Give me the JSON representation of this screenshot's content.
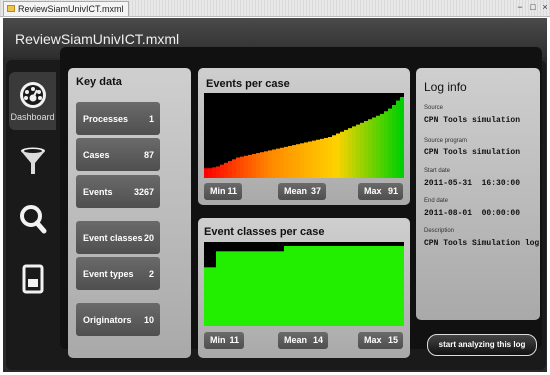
{
  "window": {
    "tab_title": "ReviewSiamUnivICT.mxml",
    "app_title": "ReviewSiamUnivICT.mxml"
  },
  "nav": {
    "items": [
      {
        "label": "Dashboard",
        "icon": "dashboard-gauge-icon",
        "active": true
      },
      {
        "label": "",
        "icon": "filter-funnel-icon"
      },
      {
        "label": "",
        "icon": "magnifier-icon"
      },
      {
        "label": "",
        "icon": "document-icon"
      }
    ]
  },
  "key_data": {
    "title": "Key data",
    "items": [
      {
        "label": "Processes",
        "value": "1"
      },
      {
        "label": "Cases",
        "value": "87"
      },
      {
        "label": "Events",
        "value": "3267"
      },
      {
        "label": "Event classes",
        "value": "20"
      },
      {
        "label": "Event types",
        "value": "2"
      },
      {
        "label": "Originators",
        "value": "10"
      }
    ]
  },
  "events_per_case": {
    "title": "Events per case",
    "min_label": "Min",
    "min": "11",
    "mean_label": "Mean",
    "mean": "37",
    "max_label": "Max",
    "max": "91"
  },
  "event_classes_per_case": {
    "title": "Event classes per case",
    "min_label": "Min",
    "min": "11",
    "mean_label": "Mean",
    "mean": "14",
    "max_label": "Max",
    "max": "15"
  },
  "log_info": {
    "title": "Log info",
    "source_label": "Source",
    "source": "CPN Tools simulation",
    "source_program_label": "Source program",
    "source_program": "CPN Tools simulation",
    "start_date_label": "Start date",
    "start_date": "2011-05-31  16:30:00",
    "end_date_label": "End date",
    "end_date": "2011-08-01  00:00:00",
    "description_label": "Description",
    "description": "CPN Tools Simulation log"
  },
  "actions": {
    "start_label": "start analyzing this log"
  },
  "chart_data": [
    {
      "type": "bar",
      "title": "Events per case",
      "ylim": [
        0,
        91
      ],
      "min": 11,
      "mean": 37,
      "max": 91,
      "values": [
        11,
        11,
        12,
        13,
        15,
        17,
        19,
        21,
        23,
        24,
        25,
        26,
        27,
        28,
        29,
        30,
        31,
        32,
        33,
        34,
        35,
        36,
        37,
        38,
        39,
        40,
        41,
        42,
        43,
        44,
        45,
        46,
        48,
        50,
        52,
        54,
        56,
        58,
        60,
        62,
        64,
        66,
        68,
        70,
        72,
        75,
        78,
        82,
        87,
        91
      ],
      "gradient": [
        "#ff0000",
        "#ff8a00",
        "#ffd200",
        "#00d000"
      ]
    },
    {
      "type": "bar",
      "title": "Event classes per case",
      "ylim": [
        0,
        15
      ],
      "min": 11,
      "mean": 14,
      "max": 15,
      "values": [
        11,
        11,
        11,
        14,
        14,
        14,
        14,
        14,
        14,
        14,
        14,
        14,
        14,
        14,
        14,
        14,
        14,
        14,
        14,
        14,
        15,
        15,
        15,
        15,
        15,
        15,
        15,
        15,
        15,
        15,
        15,
        15,
        15,
        15,
        15,
        15,
        15,
        15,
        15,
        15,
        15,
        15,
        15,
        15,
        15,
        15,
        15,
        15,
        15,
        15
      ],
      "color": "#22ee00"
    }
  ]
}
